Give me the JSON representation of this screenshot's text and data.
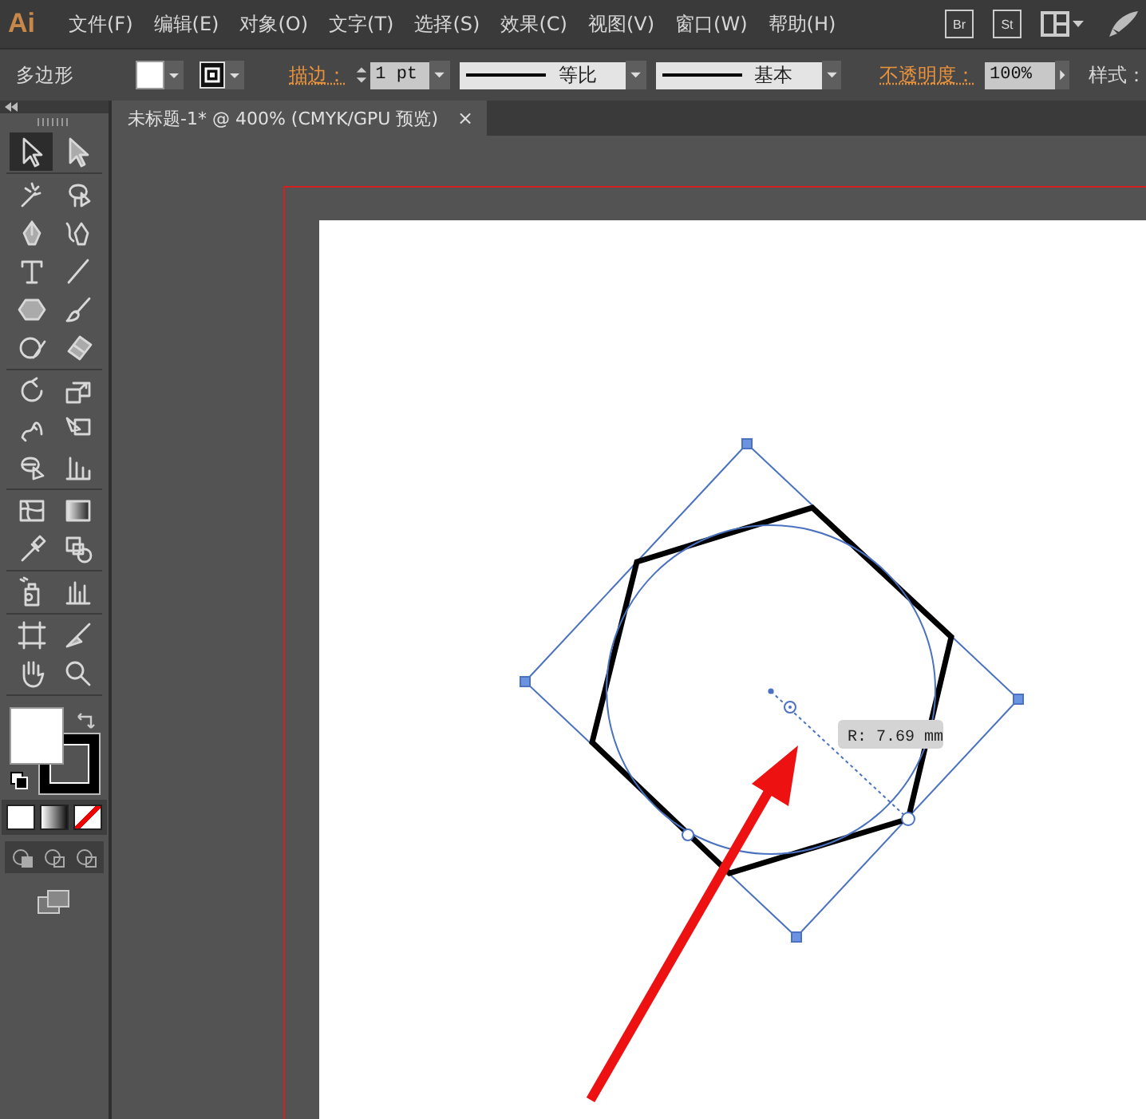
{
  "app_logo": "Ai",
  "menu": [
    "文件(F)",
    "编辑(E)",
    "对象(O)",
    "文字(T)",
    "选择(S)",
    "效果(C)",
    "视图(V)",
    "窗口(W)",
    "帮助(H)"
  ],
  "bridge_buttons": [
    "Br",
    "St"
  ],
  "control_bar": {
    "object_type": "多边形",
    "stroke_label": "描边：",
    "stroke_weight": "1 pt",
    "variable_width": "等比",
    "brush": "基本",
    "opacity_label": "不透明度：",
    "opacity": "100%",
    "style_label": "样式："
  },
  "document_tab": {
    "title": "未标题-1* @ 400% (CMYK/GPU 预览)",
    "close": "×"
  },
  "tools": [
    {
      "kind": "selection",
      "selected": true
    },
    {
      "kind": "direct-selection",
      "selected": false
    },
    {
      "kind": "magic-wand",
      "selected": false
    },
    {
      "kind": "lasso",
      "selected": false
    },
    {
      "kind": "pen",
      "selected": false
    },
    {
      "kind": "curvature",
      "selected": false
    },
    {
      "kind": "type",
      "selected": false
    },
    {
      "kind": "line",
      "selected": false
    },
    {
      "kind": "polygon",
      "selected": false
    },
    {
      "kind": "brush",
      "selected": false
    },
    {
      "kind": "shaper",
      "selected": false
    },
    {
      "kind": "eraser",
      "selected": false
    },
    {
      "kind": "rotate",
      "selected": false
    },
    {
      "kind": "scale",
      "selected": false
    },
    {
      "kind": "puppet",
      "selected": false
    },
    {
      "kind": "free-transform",
      "selected": false
    },
    {
      "kind": "shape-builder",
      "selected": false
    },
    {
      "kind": "stacked-graph",
      "selected": false
    },
    {
      "kind": "mesh",
      "selected": false
    },
    {
      "kind": "gradient",
      "selected": false
    },
    {
      "kind": "eyedropper",
      "selected": false
    },
    {
      "kind": "blend",
      "selected": false
    },
    {
      "kind": "sprayer",
      "selected": false
    },
    {
      "kind": "column-graph",
      "selected": false
    },
    {
      "kind": "artboard",
      "selected": false
    },
    {
      "kind": "slice",
      "selected": false
    },
    {
      "kind": "hand",
      "selected": false
    },
    {
      "kind": "zoom",
      "selected": false
    }
  ],
  "canvas": {
    "radius_label": "R: 7.69 mm"
  }
}
